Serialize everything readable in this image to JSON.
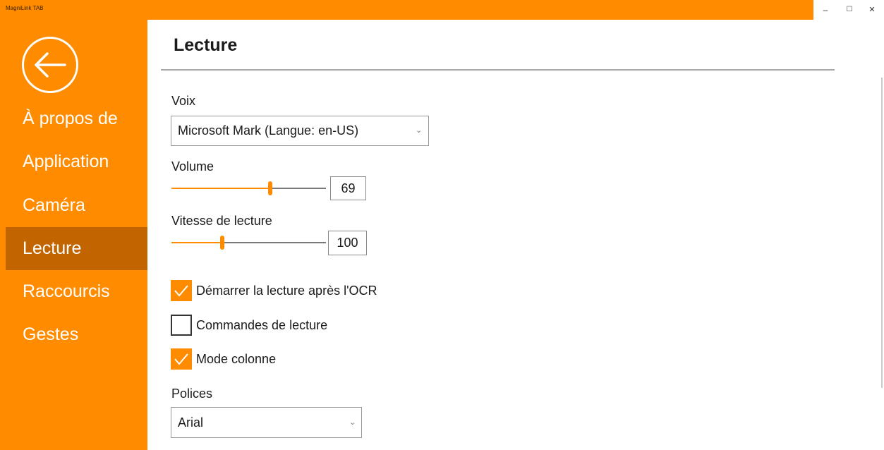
{
  "window": {
    "title": "MagniLink TAB",
    "controls": {
      "minimize": "–",
      "maximize": "☐",
      "close": "✕"
    }
  },
  "sidebar": {
    "back_icon": "back-arrow-circle-icon",
    "items": [
      {
        "label": "À propos de",
        "active": false
      },
      {
        "label": "Application",
        "active": false
      },
      {
        "label": "Caméra",
        "active": false
      },
      {
        "label": "Lecture",
        "active": true
      },
      {
        "label": "Raccourcis",
        "active": false
      },
      {
        "label": "Gestes",
        "active": false
      }
    ]
  },
  "main": {
    "title": "Lecture",
    "voice": {
      "label": "Voix",
      "value": "Microsoft Mark (Langue: en-US)"
    },
    "volume": {
      "label": "Volume",
      "value": "69",
      "level": 0.64
    },
    "speed": {
      "label": "Vitesse de lecture",
      "value": "100",
      "level": 0.33
    },
    "checkboxes": [
      {
        "label": "Démarrer la lecture après l'OCR",
        "checked": true
      },
      {
        "label": "Commandes de lecture",
        "checked": false
      },
      {
        "label": "Mode colonne",
        "checked": true
      }
    ],
    "fonts": {
      "label": "Polices",
      "value": "Arial"
    }
  },
  "colors": {
    "accent": "#ff8c00",
    "active_nav": "#c26400",
    "track_off": "#7a7a7a"
  }
}
